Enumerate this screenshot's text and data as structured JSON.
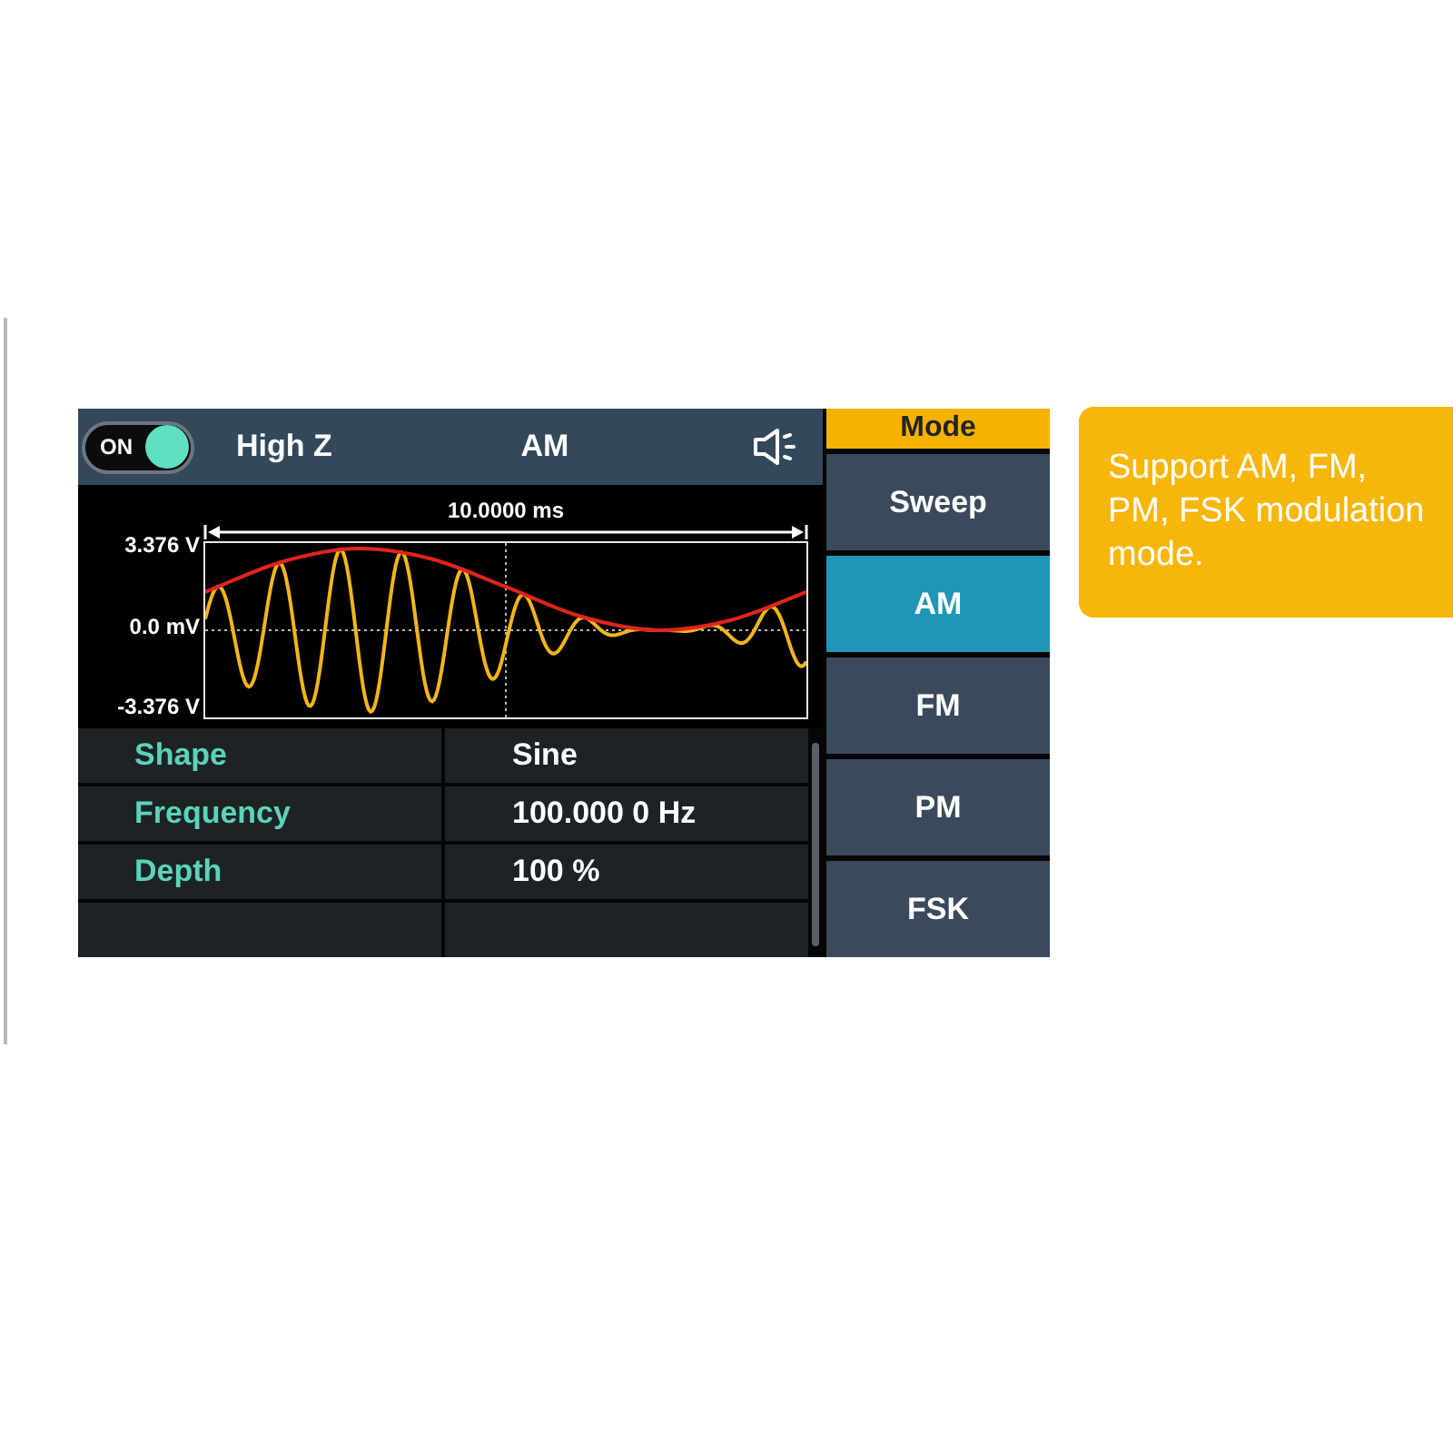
{
  "screen": {
    "header": {
      "output": {
        "label": "ON",
        "on": true
      },
      "load": "High Z",
      "title": "AM"
    },
    "waveform": {
      "span": "10.0000 ms",
      "y_labels": [
        "3.376 V",
        "0.0 mV",
        "-3.376 V"
      ]
    },
    "parameters": [
      {
        "name": "Shape",
        "value": "Sine"
      },
      {
        "name": "Frequency",
        "value": "100.000 0 Hz"
      },
      {
        "name": "Depth",
        "value": "100 %"
      }
    ],
    "menu": {
      "title": "Mode",
      "items": [
        {
          "label": "Sweep",
          "selected": false
        },
        {
          "label": "AM",
          "selected": true
        },
        {
          "label": "FM",
          "selected": false
        },
        {
          "label": "PM",
          "selected": false
        },
        {
          "label": "FSK",
          "selected": false
        }
      ]
    }
  },
  "callout": {
    "text": "Support AM, FM, PM, FSK modulation mode."
  }
}
